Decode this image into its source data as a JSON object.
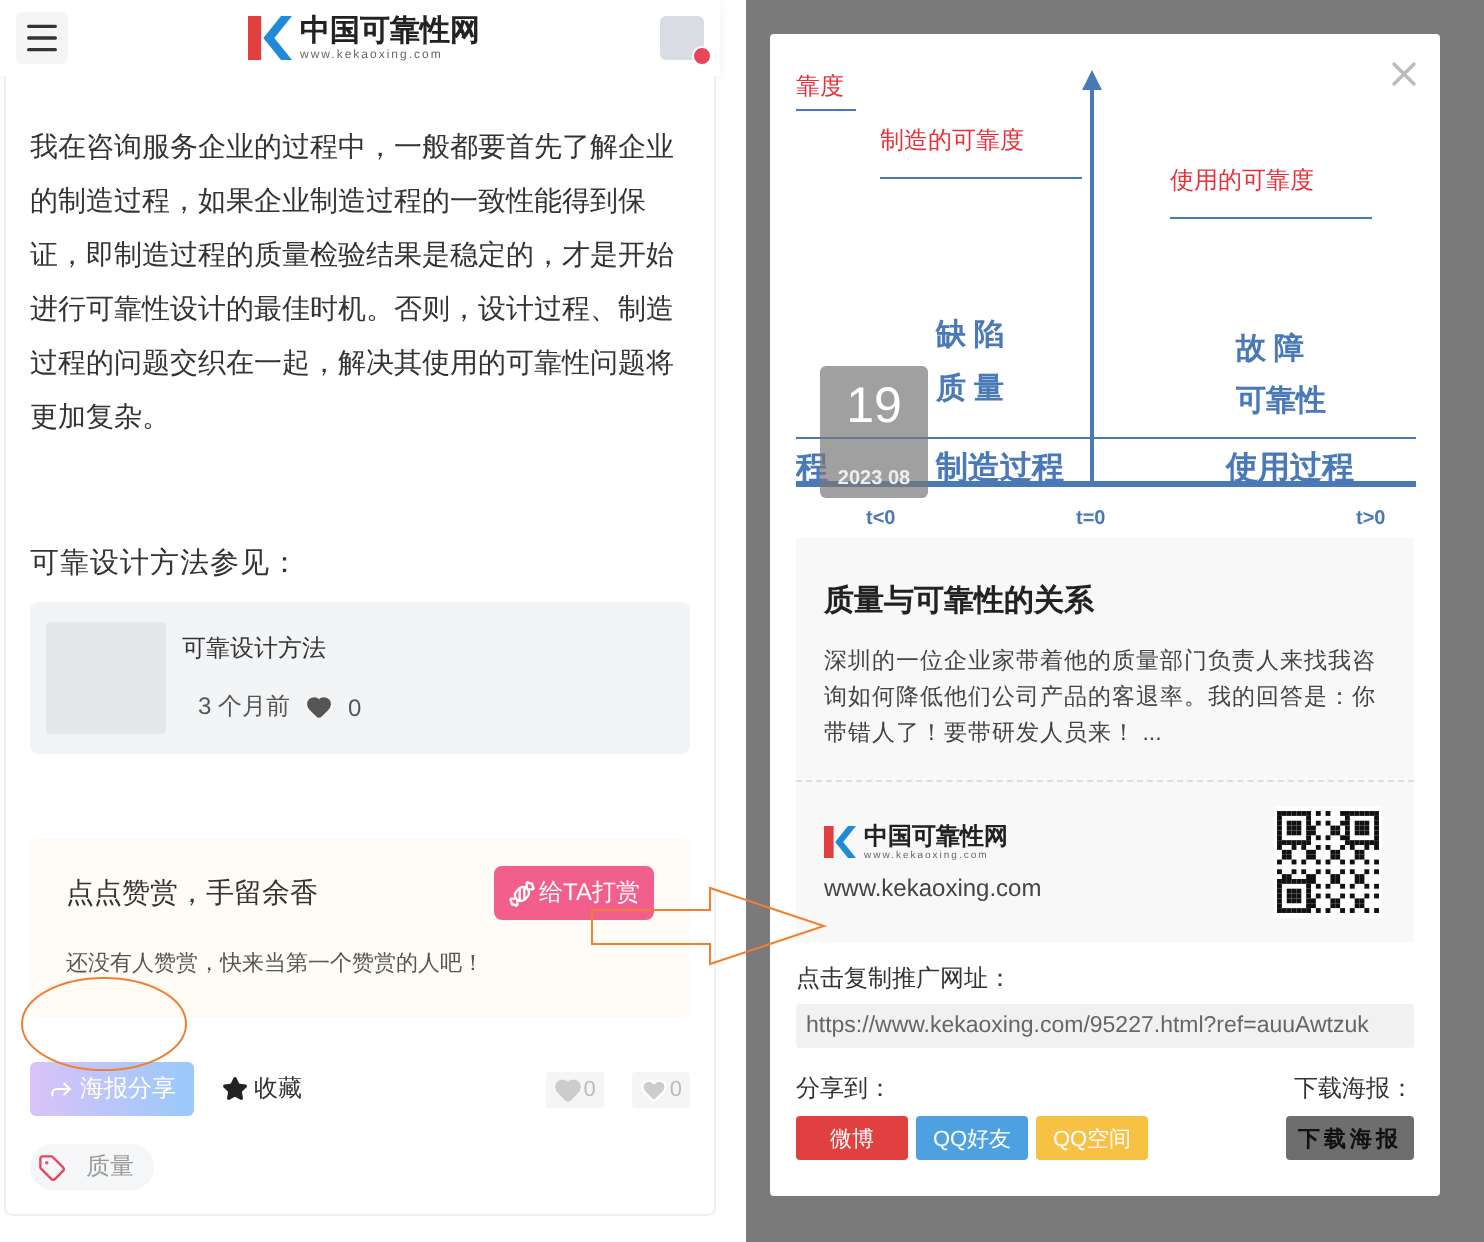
{
  "header": {
    "logo_name": "中国可靠性网",
    "logo_url": "www.kekaoxing.com"
  },
  "article": {
    "paragraph": "我在咨询服务企业的过程中，一般都要首先了解企业的制造过程，如果企业制造过程的一致性能得到保证，即制造过程的质量检验结果是稳定的，才是开始进行可靠性设计的最佳时机。否则，设计过程、制造过程的问题交织在一起，解决其使用的可靠性问题将更加复杂。",
    "see_also": "可靠设计方法参见：",
    "related": {
      "title": "可靠设计方法",
      "time": "3 个月前",
      "likes": "0"
    }
  },
  "reward": {
    "title": "点点赞赏，手留余香",
    "subtitle": "还没有人赞赏，快来当第一个赞赏的人吧！",
    "button": "给TA打赏"
  },
  "actions": {
    "share": "海报分享",
    "favorite": "收藏",
    "likes": "0",
    "dislikes": "0"
  },
  "tags": [
    "质量"
  ],
  "modal": {
    "diagram_labels": [
      {
        "text": "靠度",
        "kind": "red"
      },
      {
        "text": "制造的可靠度",
        "kind": "red"
      },
      {
        "text": "使用的可靠度",
        "kind": "red"
      },
      {
        "text": "缺 陷",
        "kind": "blue"
      },
      {
        "text": "质 量",
        "kind": "blue"
      },
      {
        "text": "故 障",
        "kind": "blue"
      },
      {
        "text": "可靠性",
        "kind": "blue"
      },
      {
        "text": "程",
        "kind": "big"
      },
      {
        "text": "制造过程",
        "kind": "big"
      },
      {
        "text": "使用过程",
        "kind": "big"
      },
      {
        "text": "t<0",
        "kind": "axis"
      },
      {
        "text": "t=0",
        "kind": "axis"
      },
      {
        "text": "t>0",
        "kind": "axis"
      }
    ],
    "date": {
      "day": "19",
      "month": "2023 08"
    },
    "title": "质量与可靠性的关系",
    "excerpt": "深圳的一位企业家带着他的质量部门负责人来找我咨询如何降低他们公司产品的客退率。我的回答是：你带错人了！要带研发人员来！ ...",
    "brand_name": "中国可靠性网",
    "brand_url": "www.kekaoxing.com",
    "site": "www.kekaoxing.com",
    "copy_label": "点击复制推广网址：",
    "url": "https://www.kekaoxing.com/95227.html?ref=auuAwtzuk",
    "share_label": "分享到：",
    "share_buttons": [
      {
        "label": "微博",
        "color": "#e0403f"
      },
      {
        "label": "QQ好友",
        "color": "#4ea1e0"
      },
      {
        "label": "QQ空间",
        "color": "#f7c244"
      }
    ],
    "download_label": "下载海报：",
    "download_button": "下载海报"
  }
}
